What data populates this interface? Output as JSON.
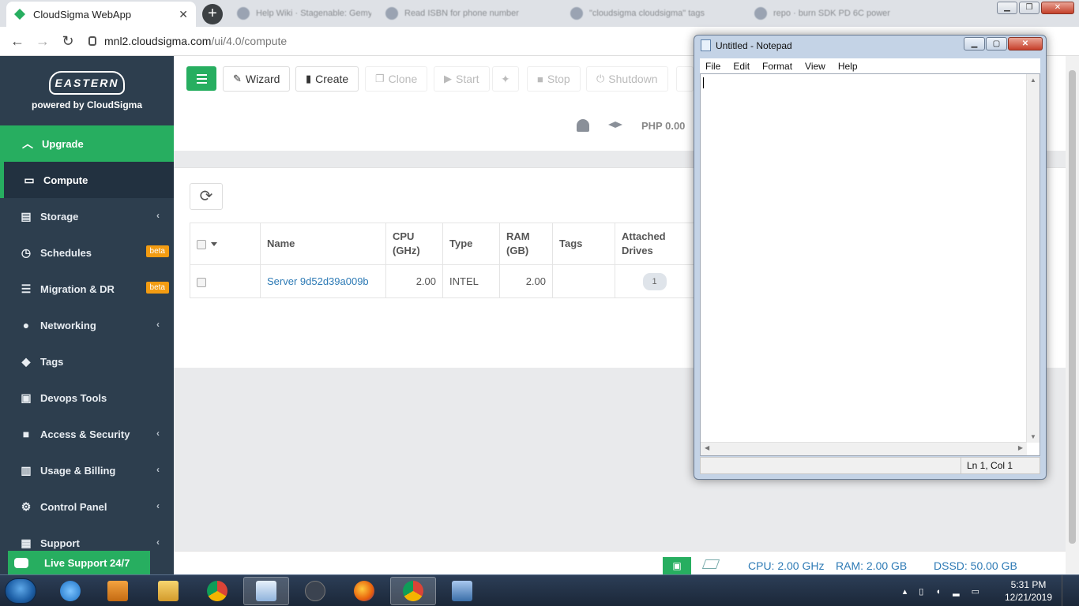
{
  "browser": {
    "active_tab_title": "CloudSigma WebApp",
    "background_tabs": [
      "Help Wiki · Stagenable: Gemy",
      "Read ISBN for phone number",
      "\"cloudsigma cloudsigma\" tags",
      "repo · burn SDK PD 6C power"
    ],
    "url_host": "mnl2.cloudsigma.com",
    "url_path": "/ui/4.0/compute"
  },
  "sidebar": {
    "logo_text": "EASTERN",
    "powered_by": "powered by CloudSigma",
    "upgrade_label": "Upgrade",
    "active_item": "Compute",
    "items": [
      {
        "label": "Storage",
        "icon": "hdd-icon",
        "chevron": true
      },
      {
        "label": "Schedules",
        "icon": "clock-icon",
        "badge": "beta"
      },
      {
        "label": "Migration & DR",
        "icon": "server-stack-icon",
        "badge": "beta"
      },
      {
        "label": "Networking",
        "icon": "globe-icon",
        "chevron": true
      },
      {
        "label": "Tags",
        "icon": "tag-icon"
      },
      {
        "label": "Devops Tools",
        "icon": "terminal-icon"
      },
      {
        "label": "Access & Security",
        "icon": "lock-icon",
        "chevron": true
      },
      {
        "label": "Usage & Billing",
        "icon": "bar-chart-icon",
        "chevron": true
      },
      {
        "label": "Control Panel",
        "icon": "cogs-icon",
        "chevron": true
      },
      {
        "label": "Support",
        "icon": "lifebuoy-icon",
        "chevron": true
      }
    ],
    "live_support": "Live Support 24/7"
  },
  "toolbar": {
    "wizard": "Wizard",
    "create": "Create",
    "clone": "Clone",
    "start": "Start",
    "stop": "Stop",
    "shutdown": "Shutdown",
    "price": "PHP 0.00"
  },
  "table": {
    "headers": {
      "name": "Name",
      "cpu": "CPU",
      "cpu_unit": "(GHz)",
      "type": "Type",
      "ram": "RAM",
      "ram_unit": "(GB)",
      "tags": "Tags",
      "drives": "Attached",
      "drives2": "Drives"
    },
    "rows": [
      {
        "name": "Server 9d52d39a009b",
        "cpu": "2.00",
        "type": "INTEL",
        "ram": "2.00",
        "tags": "",
        "drives": "1"
      }
    ]
  },
  "status_bar": {
    "cpu": "CPU: 2.00 GHz",
    "ram": "RAM: 2.00 GB",
    "dssd": "DSSD: 50.00 GB"
  },
  "notepad": {
    "title": "Untitled - Notepad",
    "menu": [
      "File",
      "Edit",
      "Format",
      "View",
      "Help"
    ],
    "status": "Ln 1, Col 1"
  },
  "taskbar": {
    "time": "5:31 PM",
    "date": "12/21/2019"
  },
  "colors": {
    "accent_green": "#27ae60",
    "sidebar_bg": "#2d3e4e",
    "link_blue": "#2d7ab5",
    "beta_orange": "#f39c12"
  }
}
